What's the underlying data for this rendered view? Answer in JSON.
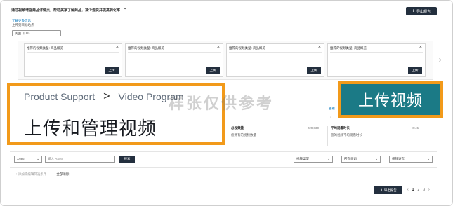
{
  "header": {
    "title": "通过视频增强商品详情页，帮助买家了解商品，减少退货并提高转化率",
    "export_button": "导出报告",
    "learn_more": "了解更多信息",
    "marketplace_label": "上传到目标站点",
    "marketplace_value": "美国（US）"
  },
  "upload_cards": [
    {
      "title": "推荐的视频类型: 商品概览",
      "button": "上传"
    },
    {
      "title": "推荐的视频类型: 商品概览",
      "button": "上传"
    },
    {
      "title": "推荐的视频类型: 商品概览",
      "button": "上传"
    },
    {
      "title": "推荐的视频类型: 商品概览",
      "button": "上传"
    }
  ],
  "breadcrumb": {
    "part1": "Product Support",
    "sep": ">",
    "part2": "Video Program"
  },
  "page_title": "上传和管理视频",
  "upload_video_button": "上传视频",
  "watermark": "样张仅供参考",
  "side_link": "查看",
  "stats": [
    {
      "heading": "总视频量",
      "right": "229,830",
      "sub": "您拥有的视频数量"
    },
    {
      "heading": "平均观看时长",
      "right": "0:45",
      "sub": "您的视频平均观看时长"
    }
  ],
  "filters": {
    "scope_select": "ASIN",
    "search_placeholder": "输入 ASIN",
    "search_button": "搜索",
    "type_select": "视频类型",
    "status_select": "所有状态",
    "date_select": "视频语言"
  },
  "checks": {
    "item1": "+ 添加或编辑筛选条件",
    "item2": "全部清除"
  },
  "footer": {
    "export": "导出报告",
    "pages": [
      "‹",
      "1",
      "2",
      "3",
      "›"
    ]
  }
}
